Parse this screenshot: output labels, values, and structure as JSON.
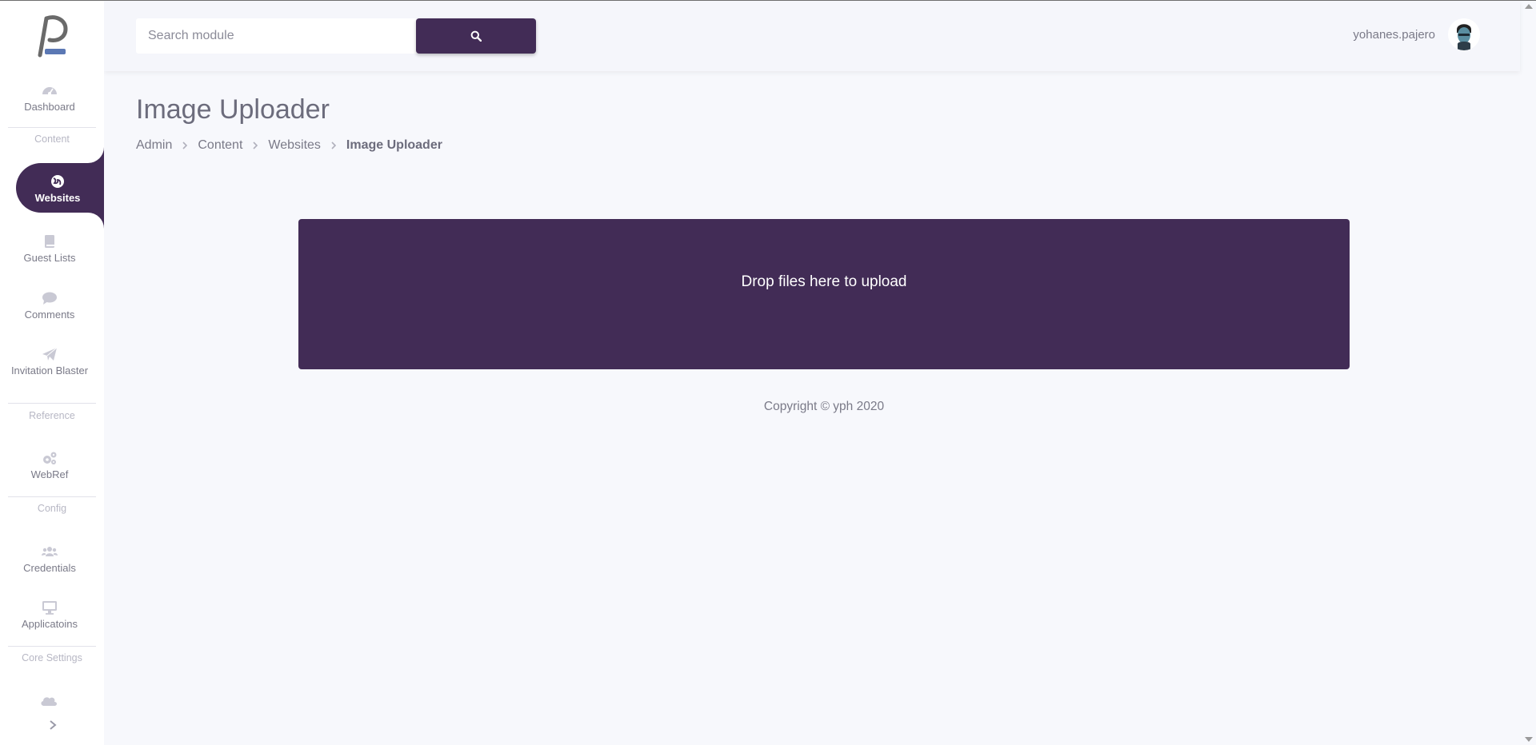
{
  "sidebar": {
    "items": [
      {
        "label": "Dashboard",
        "icon": "dashboard-icon"
      },
      {
        "label": "Websites",
        "icon": "globe-icon",
        "active": true
      },
      {
        "label": "Guest Lists",
        "icon": "book-icon"
      },
      {
        "label": "Comments",
        "icon": "comment-icon"
      },
      {
        "label": "Invitation Blaster",
        "icon": "paper-plane-icon"
      },
      {
        "label": "WebRef",
        "icon": "cogs-icon"
      },
      {
        "label": "Credentials",
        "icon": "users-icon"
      },
      {
        "label": "Applicatoins",
        "icon": "desktop-icon"
      }
    ],
    "sections": {
      "content": "Content",
      "reference": "Reference",
      "config": "Config",
      "core_settings": "Core Settings"
    }
  },
  "header": {
    "search_placeholder": "Search module",
    "username": "yohanes.pajero"
  },
  "main": {
    "title": "Image Uploader",
    "breadcrumb": [
      "Admin",
      "Content",
      "Websites",
      "Image Uploader"
    ],
    "dropzone_text": "Drop files here to upload",
    "copyright": "Copyright © yph 2020"
  },
  "colors": {
    "accent": "#422c56",
    "background": "#f7f8fc",
    "sidebar": "#ffffff"
  }
}
